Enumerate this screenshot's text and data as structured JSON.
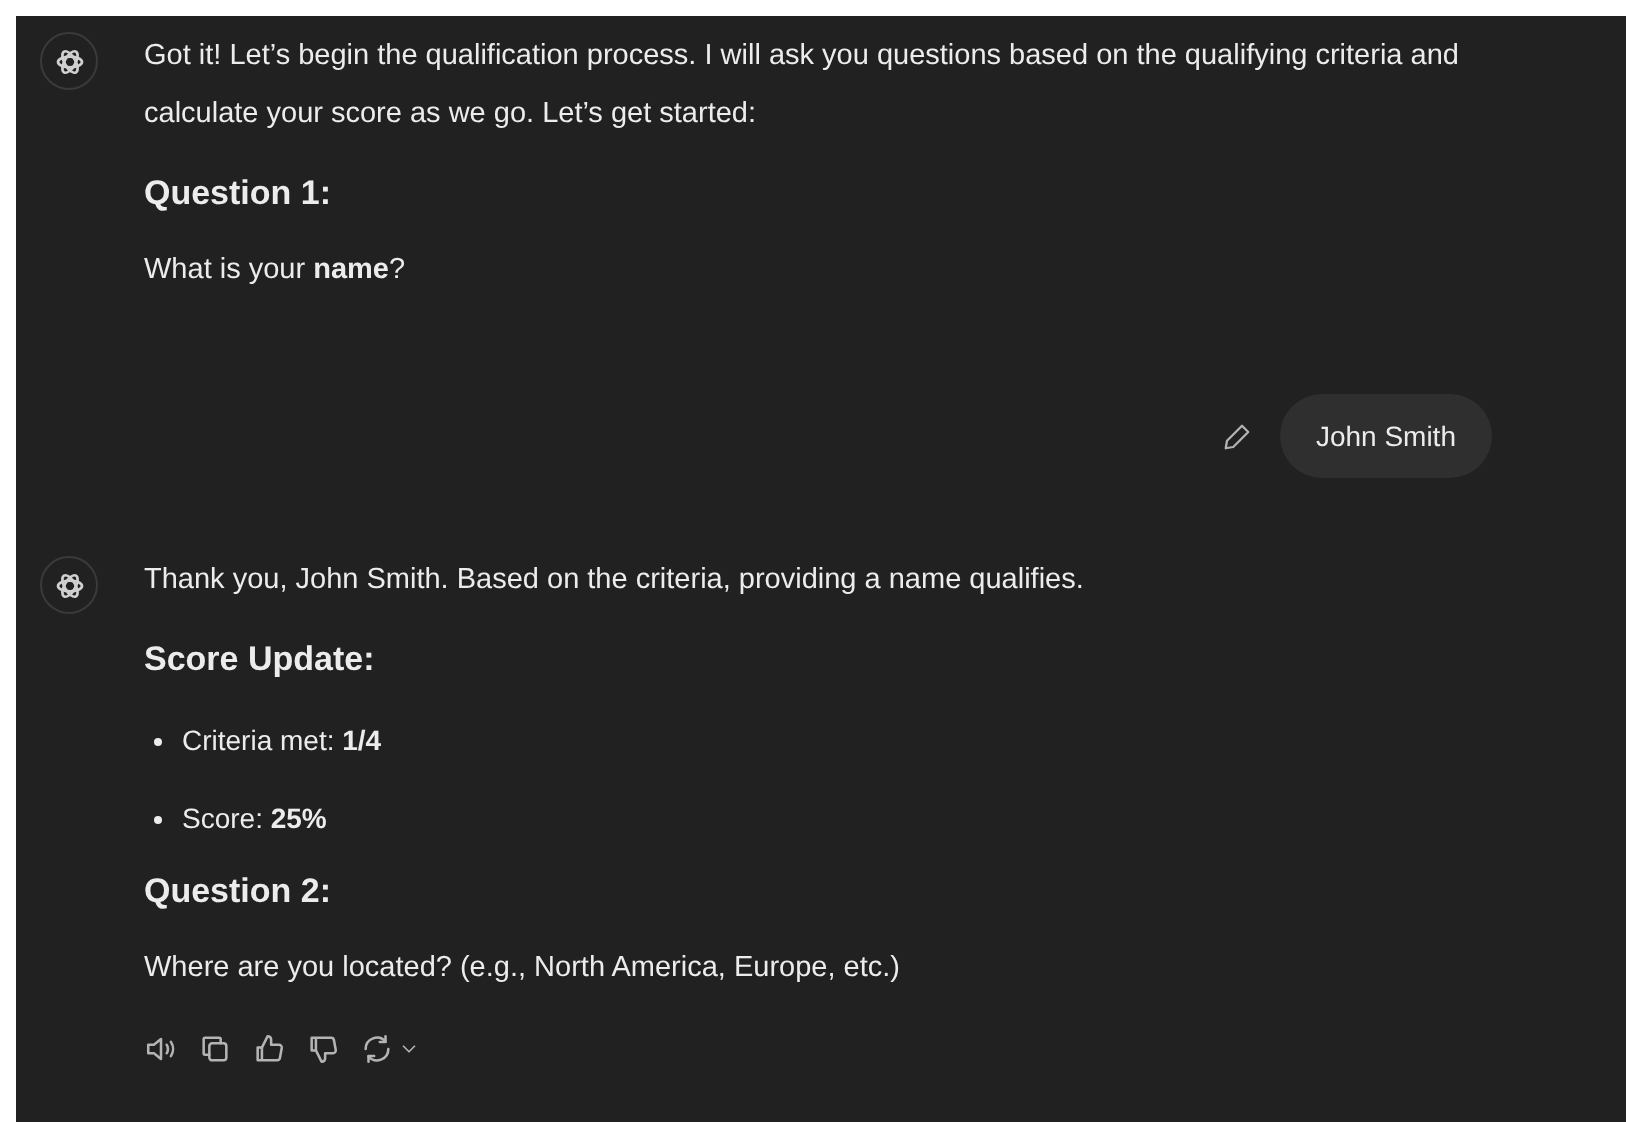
{
  "messages": [
    {
      "kind": "assistant",
      "blocks": [
        {
          "kind": "paragraph",
          "text": "Got it! Let’s begin the qualification process. I will ask you questions based on the qualifying criteria and calculate your score as we go. Let’s get started:"
        },
        {
          "kind": "heading",
          "text": "Question 1:"
        },
        {
          "kind": "paragraph",
          "text": "What is your **name**?"
        }
      ],
      "actions": false
    },
    {
      "kind": "user",
      "text": "John Smith",
      "editable": true
    },
    {
      "kind": "assistant",
      "blocks": [
        {
          "kind": "paragraph",
          "text": "Thank you, John Smith. Based on the criteria, providing a name qualifies."
        },
        {
          "kind": "heading",
          "text": "Score Update:"
        },
        {
          "kind": "list",
          "items": [
            "Criteria met: **1/4**",
            "Score: **25%**"
          ]
        },
        {
          "kind": "heading",
          "text": "Question 2:"
        },
        {
          "kind": "paragraph",
          "text": "Where are you located? (e.g., North America, Europe, etc.)"
        }
      ],
      "actions": true
    }
  ]
}
